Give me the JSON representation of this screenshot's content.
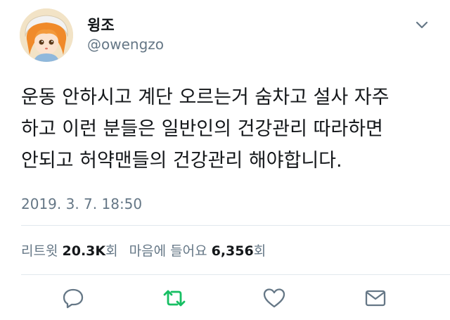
{
  "header": {
    "display_name": "윙조",
    "handle": "@owengzo"
  },
  "tweet": {
    "lines": [
      "운동 안하시고 계단 오르는거 숨차고 설사 자주",
      "하고 이런 분들은 일반인의 건강관리 따라하면",
      "안되고 허약맨들의 건강관리 해야합니다."
    ],
    "timestamp": "2019. 3. 7. 18:50"
  },
  "stats": {
    "retweet_label": "리트윗",
    "retweet_count": "20.3K",
    "retweet_suffix": "회",
    "like_label": "마음에 들어요",
    "like_count": "6,356",
    "like_suffix": "회"
  },
  "actions": {
    "reply_icon": "reply-icon",
    "retweet_icon": "retweet-icon",
    "like_icon": "heart-icon",
    "dm_icon": "envelope-icon"
  },
  "colors": {
    "text": "#14171a",
    "secondary": "#657786",
    "divider": "#e1e8ed",
    "retweet_green": "#17bf63"
  }
}
